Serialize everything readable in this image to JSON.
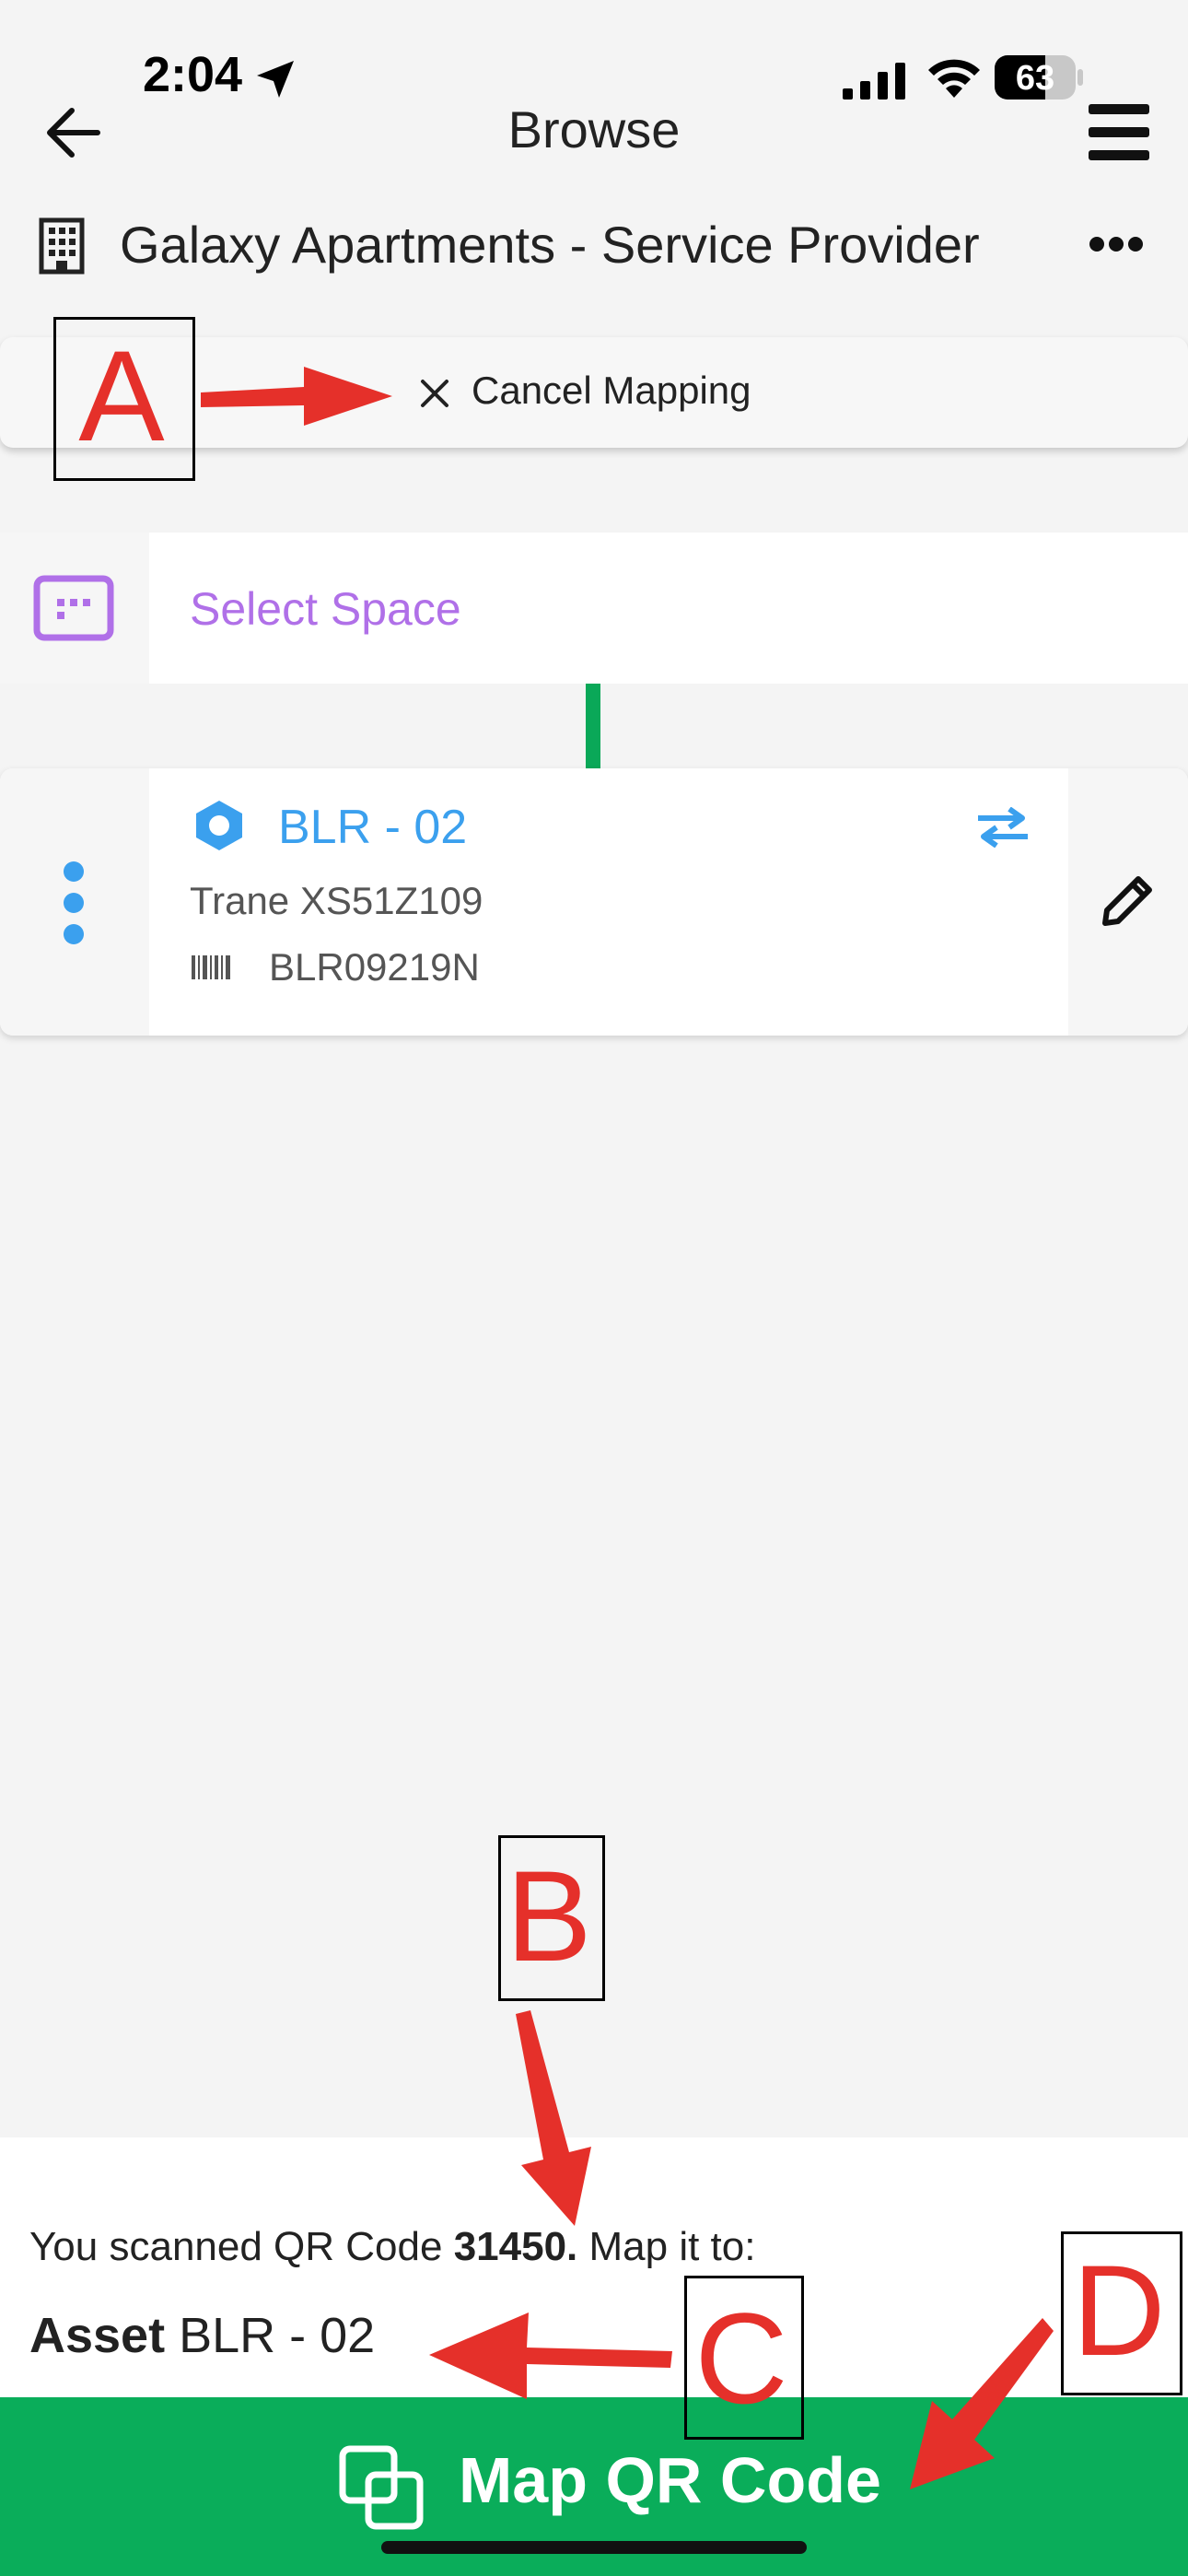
{
  "status_bar": {
    "time": "2:04",
    "battery": "63"
  },
  "nav": {
    "title": "Browse"
  },
  "building": {
    "name": "Galaxy Apartments - Service Provider"
  },
  "cancel_mapping": {
    "label": "Cancel Mapping"
  },
  "space": {
    "label": "Select Space"
  },
  "asset": {
    "name": "BLR - 02",
    "model": "Trane XS51Z109",
    "serial": "BLR09219N"
  },
  "bottom": {
    "scan_prefix": "You scanned QR Code ",
    "qr_code": "31450.",
    "scan_suffix": " Map it to:",
    "target_kind": "Asset",
    "target_name": " BLR - 02"
  },
  "map_button": {
    "label": "Map QR Code"
  },
  "annotations": {
    "a": "A",
    "b": "B",
    "c": "C",
    "d": "D"
  },
  "colors": {
    "accent_green": "#0aad5a",
    "space_purple": "#b070e8",
    "asset_blue": "#3ba0ee",
    "annotation_red": "#e5302a"
  }
}
